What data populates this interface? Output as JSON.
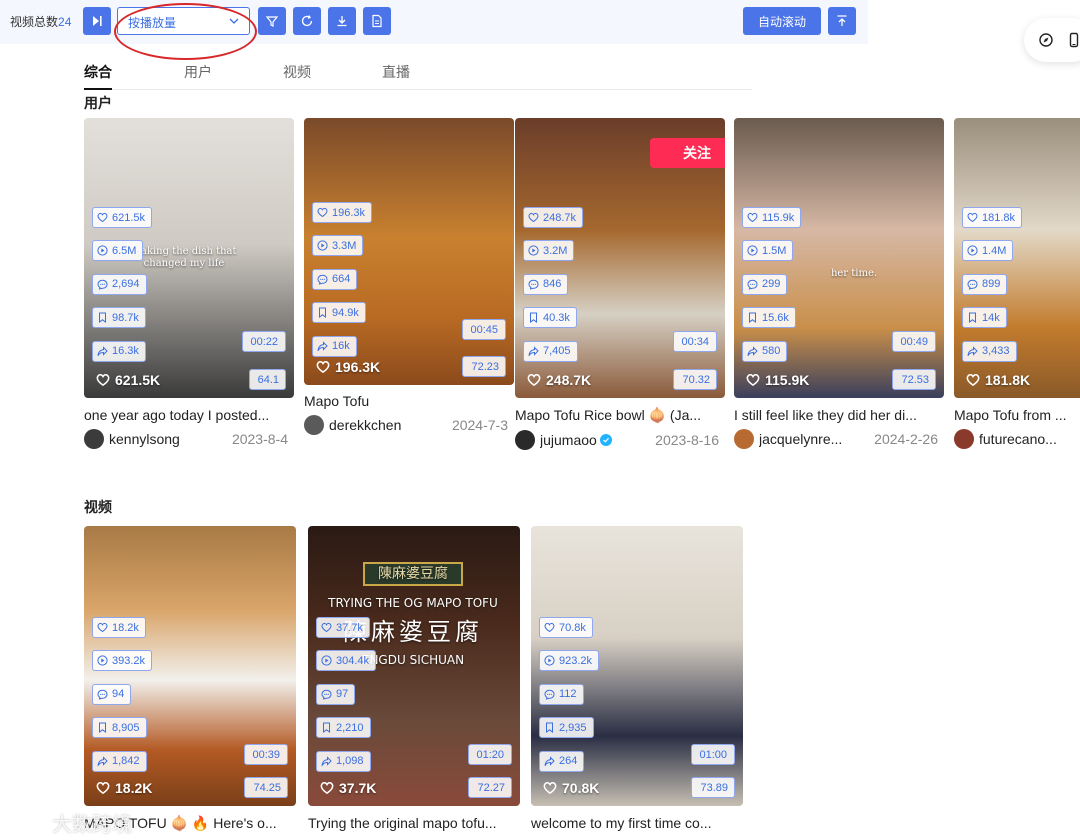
{
  "toolbar": {
    "total_label": "视频总数",
    "total_count": "24",
    "sort_select": "按播放量",
    "auto_scroll_label": "自动滚动"
  },
  "tabs": [
    "综合",
    "用户",
    "视频",
    "直播"
  ],
  "sections": {
    "users": "用户",
    "videos": "视频"
  },
  "user_cards": [
    {
      "likes": "621.5k",
      "plays": "6.5M",
      "comments": "2,694",
      "saves": "98.7k",
      "shares": "16.3k",
      "duration": "00:22",
      "rate": "64.1",
      "big_likes": "621.5K",
      "overlay": "making the dish that changed my life",
      "title": "one year ago today I posted...",
      "author": "kennylsong",
      "date": "2023-8-4",
      "follow": ""
    },
    {
      "likes": "196.3k",
      "plays": "3.3M",
      "comments": "664",
      "saves": "94.9k",
      "shares": "16k",
      "duration": "00:45",
      "rate": "72.23",
      "big_likes": "196.3K",
      "overlay": "",
      "title": "Mapo Tofu",
      "author": "derekkchen",
      "date": "2024-7-3",
      "follow": ""
    },
    {
      "likes": "248.7k",
      "plays": "3.2M",
      "comments": "846",
      "saves": "40.3k",
      "shares": "7,405",
      "duration": "00:34",
      "rate": "70.32",
      "big_likes": "248.7K",
      "overlay": "",
      "title": "Mapo Tofu Rice bowl 🧅 (Ja...",
      "author": "jujumaoo",
      "date": "2023-8-16",
      "follow": "关注"
    },
    {
      "likes": "115.9k",
      "plays": "1.5M",
      "comments": "299",
      "saves": "15.6k",
      "shares": "580",
      "duration": "00:49",
      "rate": "72.53",
      "big_likes": "115.9K",
      "overlay": "her time.",
      "title": "I still feel like they did her di...",
      "author": "jacquelynre...",
      "date": "2024-2-26",
      "follow": ""
    },
    {
      "likes": "181.8k",
      "plays": "1.4M",
      "comments": "899",
      "saves": "14k",
      "shares": "3,433",
      "duration": "",
      "rate": "",
      "big_likes": "181.8K",
      "overlay": "",
      "title": "Mapo Tofu from ...",
      "author": "futurecano...",
      "date": "",
      "follow": ""
    }
  ],
  "video_cards": [
    {
      "likes": "18.2k",
      "plays": "393.2k",
      "comments": "94",
      "saves": "8,905",
      "shares": "1,842",
      "duration": "00:39",
      "rate": "74.25",
      "big_likes": "18.2K",
      "overlay": "",
      "sign1": "",
      "sign2": "",
      "sign3": "",
      "title": "MAPO TOFU 🧅 🔥 Here's o..."
    },
    {
      "likes": "37.7k",
      "plays": "304.4k",
      "comments": "97",
      "saves": "2,210",
      "shares": "1,098",
      "duration": "01:20",
      "rate": "72.27",
      "big_likes": "37.7K",
      "overlay": "",
      "sign1": "陳麻婆豆腐",
      "sign2": "TRYING THE OG MAPO TOFU",
      "sign3": "陳麻婆豆腐",
      "sign4": "ENGDU SICHUAN",
      "title": "Trying the original mapo tofu..."
    },
    {
      "likes": "70.8k",
      "plays": "923.2k",
      "comments": "112",
      "saves": "2,935",
      "shares": "264",
      "duration": "01:00",
      "rate": "73.89",
      "big_likes": "70.8K",
      "overlay": "",
      "sign1": "",
      "sign2": "",
      "sign3": "",
      "title": "welcome to my first time co..."
    }
  ],
  "watermark": "大数跨境",
  "colors": {
    "accent": "#4a74e8",
    "follow": "#fe2c55",
    "annotation": "#d8282a"
  }
}
